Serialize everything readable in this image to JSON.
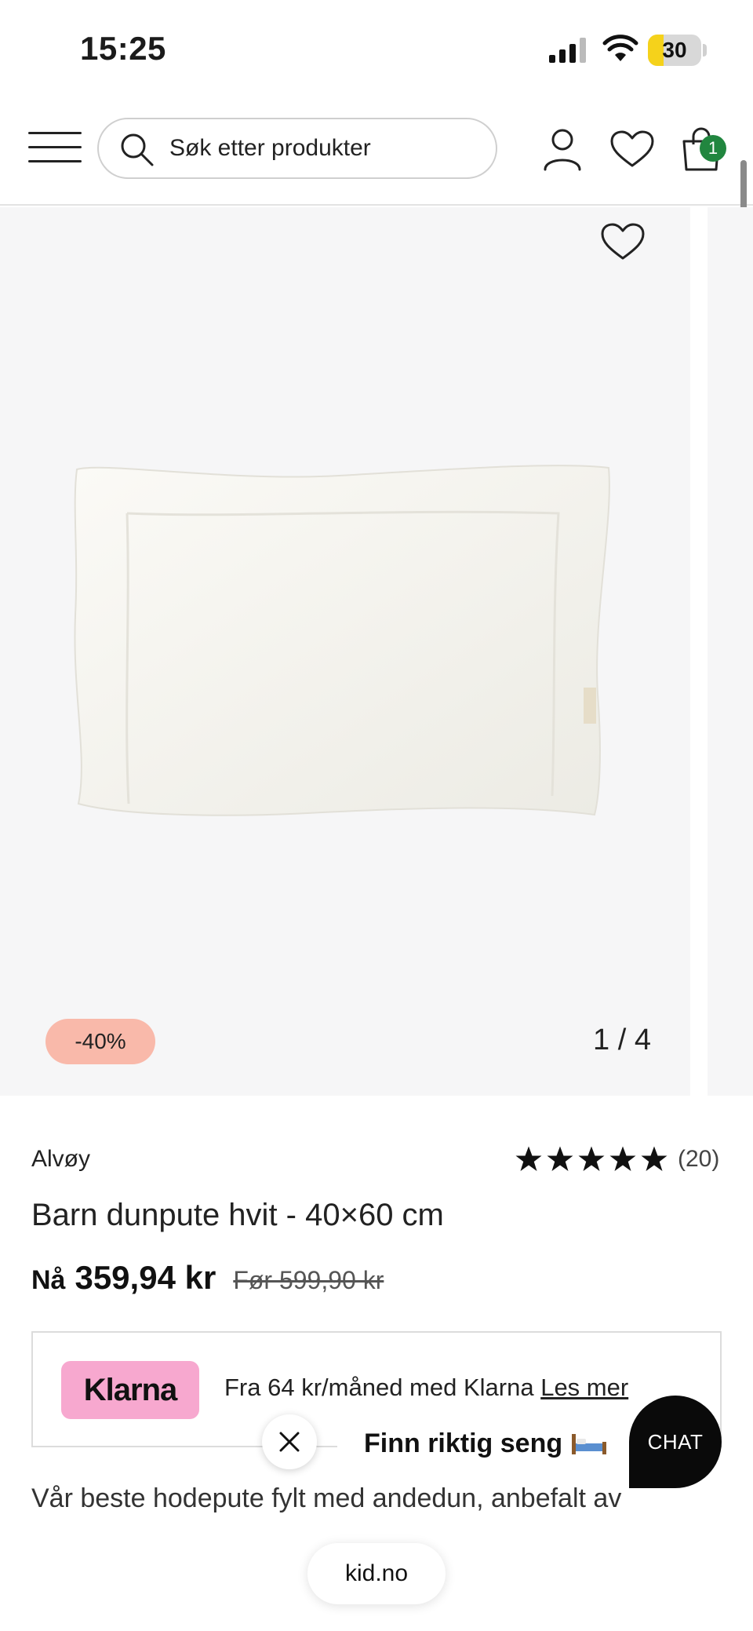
{
  "status_bar": {
    "time": "15:25",
    "battery_level": "30",
    "battery_fraction": 0.3
  },
  "header": {
    "search_placeholder": "Søk etter produkter",
    "cart_count": "1"
  },
  "gallery": {
    "discount": "-40%",
    "counter": "1 / 4"
  },
  "product": {
    "brand": "Alvøy",
    "rating_stars": 5,
    "rating_count": "(20)",
    "title": "Barn dunpute hvit - 40×60 cm",
    "price_now_label": "Nå",
    "price_now": "359,94 kr",
    "price_before": "Før 599,90 kr"
  },
  "klarna": {
    "logo": "Klarna",
    "text": "Fra 64 kr/måned med Klarna",
    "link": "Les mer"
  },
  "description": "Vår beste hodepute fylt med andedun, anbefalt av",
  "chat": {
    "bubble": "Finn riktig seng",
    "button": "CHAT"
  },
  "browser": {
    "url": "kid.no"
  },
  "colors": {
    "accent_green": "#21863f",
    "discount_bg": "#f9b9aa",
    "klarna_pink": "#f7a8cf"
  }
}
